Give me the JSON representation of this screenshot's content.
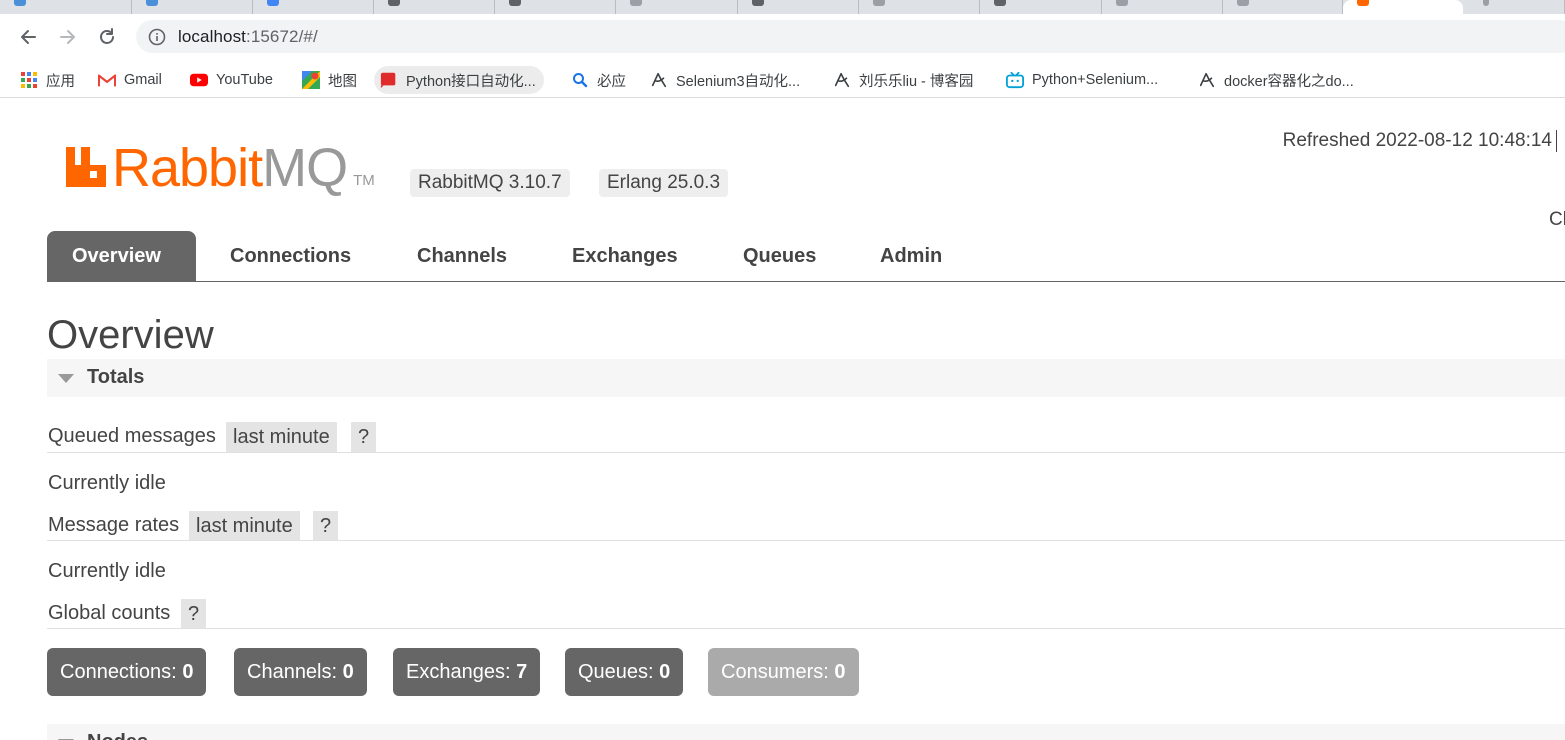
{
  "browser": {
    "url_host": "localhost",
    "url_path": ":15672/#/",
    "bookmarks": [
      {
        "label": "应用",
        "icon": "apps-grid-icon"
      },
      {
        "label": "Gmail",
        "icon": "gmail-icon"
      },
      {
        "label": "YouTube",
        "icon": "youtube-icon"
      },
      {
        "label": "地图",
        "icon": "maps-icon"
      },
      {
        "label": "Python接口自动化...",
        "icon": "red-bookmark-icon"
      },
      {
        "label": "必应",
        "icon": "bing-search-icon"
      },
      {
        "label": "Selenium3自动化...",
        "icon": "cnblogs-icon"
      },
      {
        "label": "刘乐乐liu - 博客园",
        "icon": "cnblogs-icon"
      },
      {
        "label": "Python+Selenium...",
        "icon": "bilibili-icon"
      },
      {
        "label": "docker容器化之do...",
        "icon": "cnblogs-icon"
      }
    ]
  },
  "header": {
    "logo_rabbit": "Rabbit",
    "logo_mq": "MQ",
    "logo_tm": "TM",
    "rabbitmq_version": "RabbitMQ 3.10.7",
    "erlang_version": "Erlang 25.0.3",
    "refreshed": "Refreshed 2022-08-12 10:48:14",
    "cluster_cut": "Cl"
  },
  "tabs": [
    {
      "label": "Overview",
      "active": true
    },
    {
      "label": "Connections",
      "active": false
    },
    {
      "label": "Channels",
      "active": false
    },
    {
      "label": "Exchanges",
      "active": false
    },
    {
      "label": "Queues",
      "active": false
    },
    {
      "label": "Admin",
      "active": false
    }
  ],
  "page_title": "Overview",
  "totals": {
    "section_label": "Totals",
    "queued_messages_label": "Queued messages",
    "queued_messages_range": "last minute",
    "help": "?",
    "queued_status": "Currently idle",
    "message_rates_label": "Message rates",
    "message_rates_range": "last minute",
    "rates_status": "Currently idle",
    "global_counts_label": "Global counts"
  },
  "counts": [
    {
      "label": "Connections:",
      "value": "0"
    },
    {
      "label": "Channels:",
      "value": "0"
    },
    {
      "label": "Exchanges:",
      "value": "7"
    },
    {
      "label": "Queues:",
      "value": "0"
    },
    {
      "label": "Consumers:",
      "value": "0"
    }
  ],
  "next_section_label": "Nodes",
  "colors": {
    "brand_orange": "#ff6600",
    "tab_active_bg": "#666666",
    "count_box_bg": "#666666",
    "count_box_dim_bg": "#aaaaaa"
  }
}
